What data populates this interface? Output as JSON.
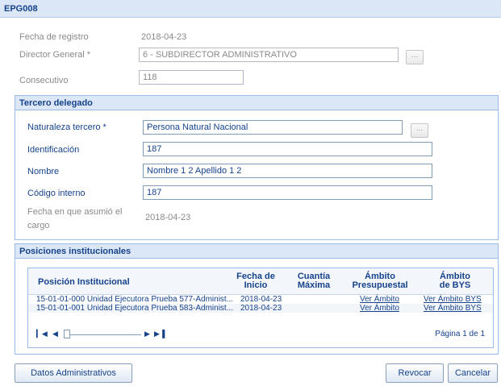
{
  "window": {
    "title": "EPG008"
  },
  "form": {
    "fecha_registro_label": "Fecha de registro",
    "fecha_registro_value": "2018-04-23",
    "director_label": "Director General *",
    "director_value": "6 - SUBDIRECTOR ADMINISTRATIVO",
    "consecutivo_label": "Consecutivo",
    "consecutivo_value": "118",
    "ellipsis": "..."
  },
  "tercero": {
    "title": "Tercero delegado",
    "naturaleza_label": "Naturaleza tercero *",
    "naturaleza_value": "Persona Natural Nacional",
    "identificacion_label": "Identificación",
    "identificacion_value": "187",
    "nombre_label": "Nombre",
    "nombre_value": "Nombre 1 2 Apellido 1 2",
    "codigo_label": "Código interno",
    "codigo_value": "187",
    "fecha_cargo_label_1": "Fecha en que asumió el",
    "fecha_cargo_label_2": "cargo",
    "fecha_cargo_value": "2018-04-23"
  },
  "posiciones": {
    "title": "Posiciones institucionales",
    "headers": {
      "posicion": "Posición Institucional",
      "fecha_1": "Fecha de",
      "fecha_2": "Inicio",
      "cuantia_1": "Cuantía",
      "cuantia_2": "Máxima",
      "ambito_pres_1": "Ámbito",
      "ambito_pres_2": "Presupuestal",
      "ambito_bys_1": "Ámbito",
      "ambito_bys_2": "de BYS"
    },
    "rows": [
      {
        "posicion": "15-01-01-000 Unidad Ejecutora Prueba 577-Administ...",
        "fecha": "2018-04-23",
        "cuantia": "",
        "ambito_pres": "Ver Ámbito",
        "ambito_bys": "Ver Ámbito BYS"
      },
      {
        "posicion": "15-01-01-001 Unidad Ejecutora Prueba 583-Administ...",
        "fecha": "2018-04-23",
        "cuantia": "",
        "ambito_pres": "Ver Ámbito",
        "ambito_bys": "Ver Ámbito BYS"
      }
    ],
    "pager_text": "Página 1 de 1"
  },
  "buttons": {
    "datos": "Datos Administrativos",
    "revocar": "Revocar",
    "cancelar": "Cancelar"
  }
}
